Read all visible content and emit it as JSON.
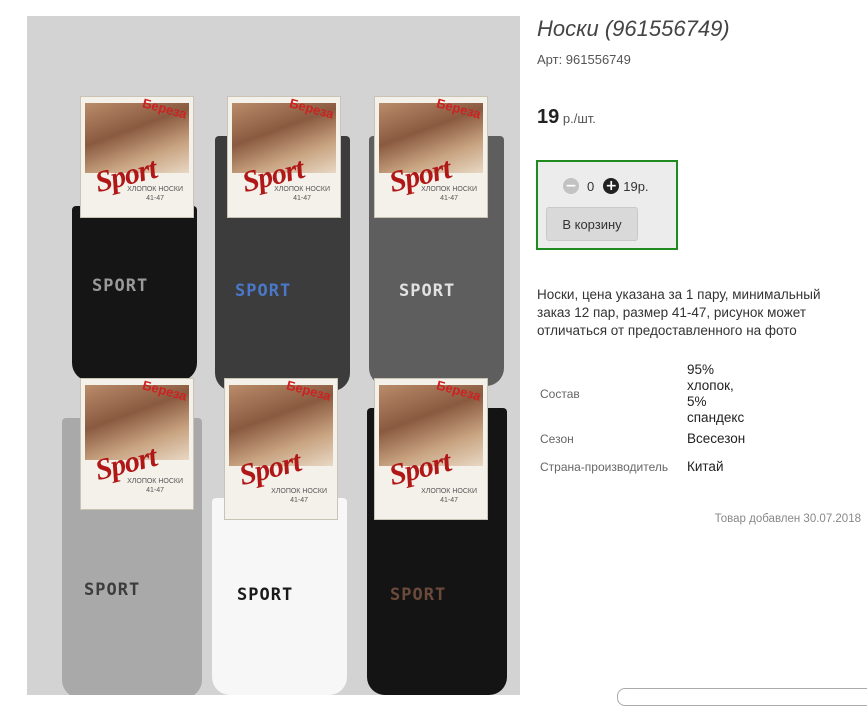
{
  "product": {
    "title": "Носки (961556749)",
    "article": "Арт: 961556749",
    "price_value": "19",
    "price_unit": "р./шт."
  },
  "cart": {
    "minus_label": "−",
    "quantity": "0",
    "plus_label": "+",
    "total": "19р.",
    "button_label": "В корзину"
  },
  "description": "Носки, цена указана за 1 пару, минимальный заказ 12 пар, размер 41-47, рисунок может отличаться от предоставленного на фото",
  "specs": [
    {
      "label": "Состав",
      "value": "95% хлопок, 5% спандекс"
    },
    {
      "label": "Сезон",
      "value": "Всесезон"
    },
    {
      "label": "Страна-производитель",
      "value": "Китай"
    }
  ],
  "added": "Товар добавлен 30.07.2018",
  "photo": {
    "packs": [
      {
        "brand": "Береза",
        "logo": "Sport",
        "card_text": "ХЛОПОК НОСКИ",
        "size": "41-47",
        "sock_text": "SPORT",
        "sock_color": "#151515",
        "text_color": "#9a9a9a"
      },
      {
        "brand": "Береза",
        "logo": "Sport",
        "card_text": "ХЛОПОК НОСКИ",
        "size": "41-47",
        "sock_text": "SPORT",
        "sock_color": "#3c3c3c",
        "text_color": "#4a78c8"
      },
      {
        "brand": "Береза",
        "logo": "Sport",
        "card_text": "ХЛОПОК НОСКИ",
        "size": "41-47",
        "sock_text": "SPORT",
        "sock_color": "#5e5e5e",
        "text_color": "#e2e2e2"
      },
      {
        "brand": "Береза",
        "logo": "Sport",
        "card_text": "ХЛОПОК НОСКИ",
        "size": "41-47",
        "sock_text": "SPORT",
        "sock_color": "#a9a9a9",
        "text_color": "#3c3c3c"
      },
      {
        "brand": "Береза",
        "logo": "Sport",
        "card_text": "ХЛОПОК НОСКИ",
        "size": "41-47",
        "sock_text": "SPORT",
        "sock_color": "#f7f7f7",
        "text_color": "#1a1a1a"
      },
      {
        "brand": "Береза",
        "logo": "Sport",
        "card_text": "ХЛОПОК НОСКИ",
        "size": "41-47",
        "sock_text": "SPORT",
        "sock_color": "#141414",
        "text_color": "#6b4a3c"
      }
    ]
  },
  "colors": {
    "accent_border": "#1f8a1f",
    "button_bg": "#d9d9d9"
  }
}
